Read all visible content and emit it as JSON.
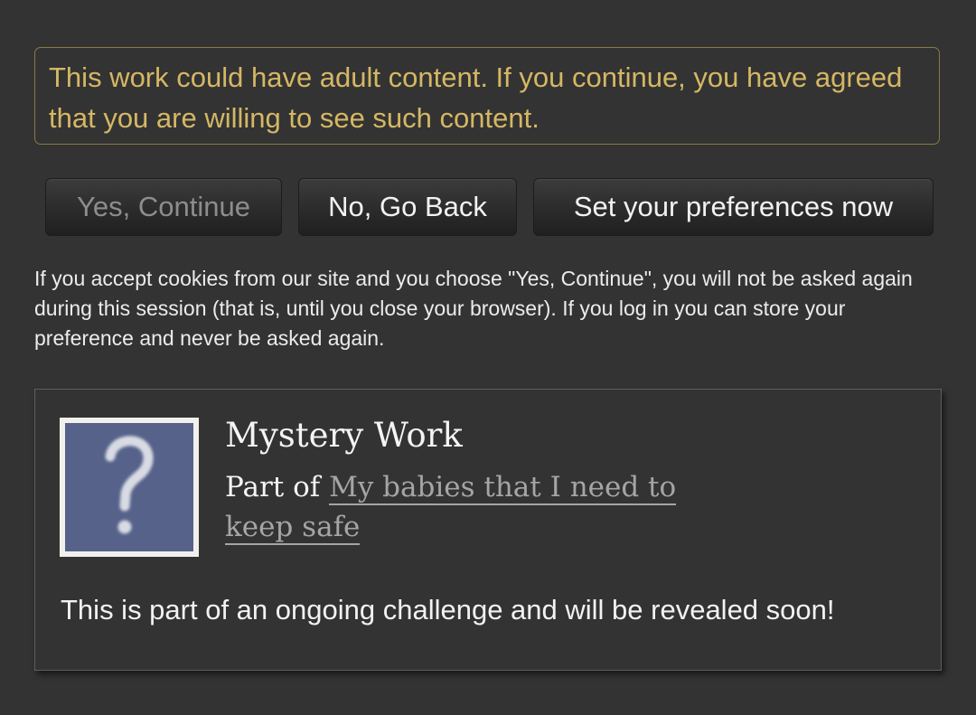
{
  "warning": {
    "text": "This work could have adult content. If you continue, you have agreed that you are willing to see such content."
  },
  "actions": {
    "yes_label": "Yes, Continue",
    "no_label": "No, Go Back",
    "prefs_label": "Set your preferences now"
  },
  "cookie_note": {
    "text": "If you accept cookies from our site and you choose \"Yes, Continue\", you will not be asked again during this session (that is, until you close your browser). If you log in you can store your preference and never be asked again."
  },
  "work": {
    "cover_icon": "question-mark-icon",
    "title": "Mystery Work",
    "series_prefix": "Part of",
    "series_title": "My babies that I need to keep safe",
    "summary": "This is part of an ongoing challenge and will be revealed soon!"
  },
  "colors": {
    "background": "#333333",
    "warning_text": "#d5b764",
    "warning_border": "#8a7a45",
    "cover_background": "#56628a",
    "link_muted": "#a5a5a5"
  }
}
